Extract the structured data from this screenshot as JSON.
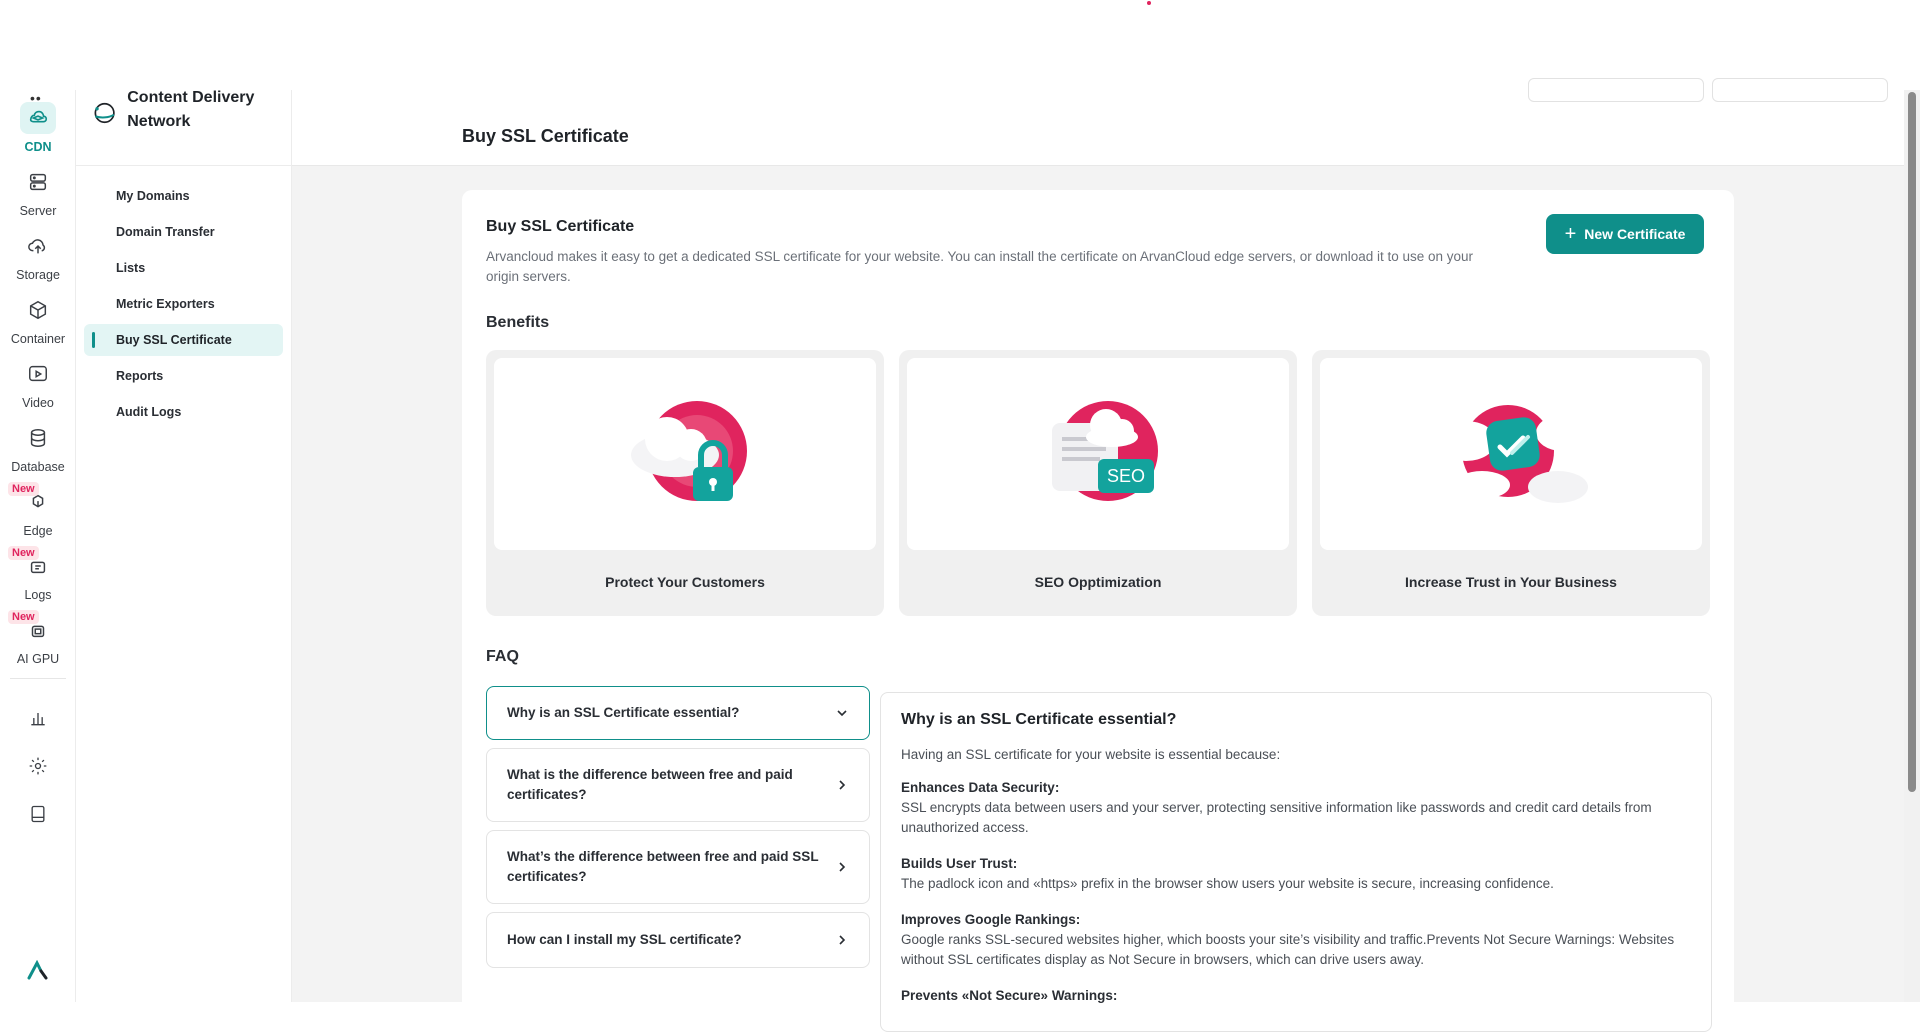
{
  "rail": {
    "top_glyph": "••",
    "items": [
      {
        "label": "CDN",
        "icon": "cdn-icon",
        "active": true
      },
      {
        "label": "Server",
        "icon": "server-icon"
      },
      {
        "label": "Storage",
        "icon": "cloud-upload-icon"
      },
      {
        "label": "Container",
        "icon": "cube-icon"
      },
      {
        "label": "Video",
        "icon": "video-icon"
      },
      {
        "label": "Database",
        "icon": "database-icon"
      },
      {
        "label": "Edge",
        "icon": "edge-icon",
        "badge": "New"
      },
      {
        "label": "Logs",
        "icon": "logs-icon",
        "badge": "New"
      },
      {
        "label": "AI GPU",
        "icon": "gpu-icon",
        "badge": "New"
      }
    ],
    "bottom_icons": [
      "chart-icon",
      "gear-icon",
      "book-icon"
    ]
  },
  "sidebar": {
    "title": "Content Delivery Network",
    "items": [
      {
        "label": "My Domains"
      },
      {
        "label": "Domain Transfer"
      },
      {
        "label": "Lists"
      },
      {
        "label": "Metric Exporters"
      },
      {
        "label": "Buy SSL Certificate",
        "active": true
      },
      {
        "label": "Reports"
      },
      {
        "label": "Audit Logs"
      }
    ]
  },
  "header": {
    "page_title": "Buy SSL Certificate"
  },
  "content": {
    "title": "Buy SSL Certificate",
    "description": "Arvancloud makes it easy to get a dedicated SSL certificate for your website. You can install the certificate on ArvanCloud edge servers, or download it to use on your origin servers.",
    "new_button": "New Certificate",
    "benefits_title": "Benefits",
    "benefits": [
      {
        "label": "Protect Your Customers",
        "icon": "lock-cloud-icon"
      },
      {
        "label": "SEO Opptimization",
        "icon": "seo-icon",
        "badge": "SEO"
      },
      {
        "label": "Increase Trust in Your Business",
        "icon": "trust-check-icon"
      }
    ],
    "faq_title": "FAQ",
    "faq": [
      {
        "question": "Why is an SSL Certificate essential?",
        "active": true
      },
      {
        "question": "What is the difference between free and paid certificates?"
      },
      {
        "question": "What’s the difference between free and paid SSL certificates?"
      },
      {
        "question": "How can I install my SSL certificate?"
      }
    ],
    "answer": {
      "title": "Why is an SSL Certificate essential?",
      "intro": "Having an SSL certificate for your website is essential because:",
      "points": [
        {
          "title": "Enhances Data Security:",
          "text": "SSL encrypts data between users and your server, protecting sensitive information like passwords and credit card details from unauthorized access."
        },
        {
          "title": "Builds User Trust:",
          "text": "The padlock icon and «https» prefix in the browser show users your website is secure, increasing confidence."
        },
        {
          "title": "Improves Google Rankings:",
          "text": "Google ranks SSL-secured websites higher, which boosts your site’s visibility and traffic.Prevents Not Secure Warnings: Websites without SSL certificates display as Not Secure in browsers, which can drive users away."
        },
        {
          "title": "Prevents «Not Secure» Warnings:",
          "text": ""
        }
      ]
    }
  },
  "colors": {
    "accent": "#0f8f8a",
    "accent_light": "#e3f5f4",
    "brand_pink": "#e0245e",
    "page_bg": "#f3f3f3"
  }
}
